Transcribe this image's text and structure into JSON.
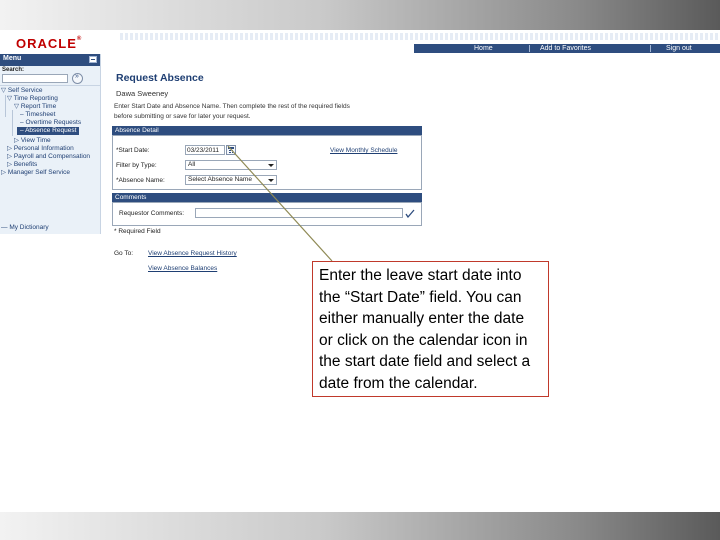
{
  "header": {
    "logo": "ORACLE",
    "nav_links": [
      "Home",
      "Add to Favorites",
      "Sign out"
    ]
  },
  "sidebar": {
    "menu_title": "Menu",
    "search_label": "Search:",
    "search_value": "",
    "items": [
      {
        "label": "Self Service",
        "glyph": "▽"
      },
      {
        "label": "Time Reporting",
        "glyph": "▽"
      },
      {
        "label": "Report Time",
        "glyph": "▽"
      },
      {
        "label": "Timesheet",
        "glyph": "–"
      },
      {
        "label": "Overtime Requests",
        "glyph": "–"
      },
      {
        "label": "Absence Request",
        "glyph": "–"
      },
      {
        "label": "View Time",
        "glyph": "▷"
      },
      {
        "label": "Personal Information",
        "glyph": "▷"
      },
      {
        "label": "Payroll and Compensation",
        "glyph": "▷"
      },
      {
        "label": "Benefits",
        "glyph": "▷"
      },
      {
        "label": "Manager Self Service",
        "glyph": "▷"
      },
      {
        "label": "My Dictionary",
        "glyph": "—"
      }
    ]
  },
  "page": {
    "title": "Request Absence",
    "employee_name": "Dawa Sweeney",
    "instructions": [
      "Enter Start Date and Absence Name. Then complete the rest of the required fields",
      "before submitting or save for later your request."
    ]
  },
  "absence_detail": {
    "section_title": "Absence Detail",
    "start_date_label": "*Start Date:",
    "start_date_value": "03/23/2011",
    "filter_label": "Filter by Type:",
    "filter_value": "All",
    "absence_name_label": "*Absence Name:",
    "absence_name_value": "Select Absence Name",
    "schedule_link": "View Monthly Schedule"
  },
  "comments": {
    "section_title": "Comments",
    "requestor_label": "Requestor Comments:",
    "requestor_value": "",
    "required_note": "* Required Field"
  },
  "goto": {
    "label": "Go To:",
    "links": [
      "View Absence Request History",
      "View Absence Balances"
    ]
  },
  "callout": {
    "lines": [
      "Enter the leave start date into",
      "the “Start Date” field.  You can",
      "either manually enter the date",
      "or click on the calendar icon in",
      "the start date field and select a",
      "date from the calendar."
    ],
    "border_color": "#c0392b",
    "pointer_color": "#8f8a55"
  }
}
